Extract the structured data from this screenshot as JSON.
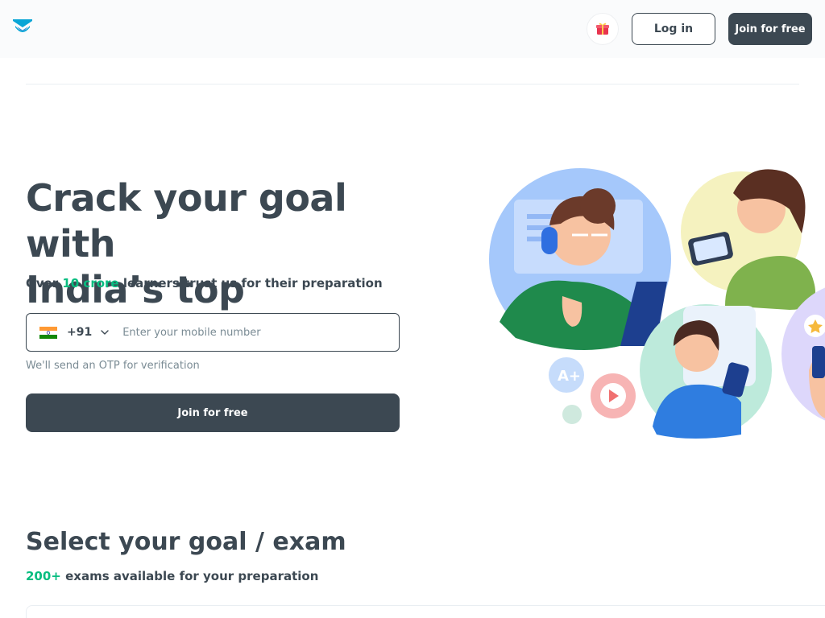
{
  "header": {
    "login_label": "Log in",
    "join_label": "Join for free",
    "gift_icon": "gift-icon",
    "logo_icon": "unacademy-logo"
  },
  "hero": {
    "title_line1": "Crack your goal with",
    "title_line2": "India’s top educators",
    "sub_prefix": "Over ",
    "sub_highlight": "10 crore",
    "sub_suffix": " learners trust us for their preparation",
    "phone": {
      "country_code": "+91",
      "placeholder": "Enter your mobile number",
      "value": ""
    },
    "otp_note": "We'll send an OTP for verification",
    "join_label": "Join for free"
  },
  "goals": {
    "title": "Select your goal / exam",
    "sub_highlight": "200+",
    "sub_suffix": " exams available for your preparation"
  },
  "colors": {
    "primary_dark": "#3c4852",
    "accent_green": "#08bd80",
    "muted_text": "#7a8b94",
    "logo_blue": "#08a5d6"
  }
}
